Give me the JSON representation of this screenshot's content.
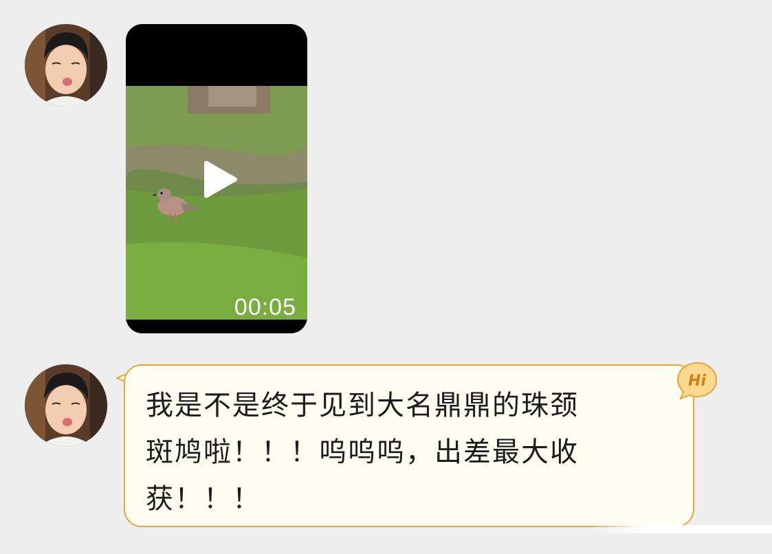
{
  "conversation": {
    "messages": [
      {
        "type": "video",
        "avatar_icon": "user-avatar-photo",
        "duration": "00:05",
        "play_icon": "play-icon"
      },
      {
        "type": "text",
        "avatar_icon": "user-avatar-photo",
        "lines": [
          "我是不是终于见到大名鼎鼎的珠颈",
          "斑鸠啦！！！呜呜呜，出差最大收",
          "获！！！"
        ],
        "bubble_colors": {
          "fill": "#fffdf1",
          "border": "#e7a53c"
        },
        "badge_label": "Hi",
        "badge_colors": {
          "fill": "#fcd98f",
          "text": "#d77a1a"
        }
      }
    ]
  },
  "colors": {
    "background": "#eeeeee"
  }
}
